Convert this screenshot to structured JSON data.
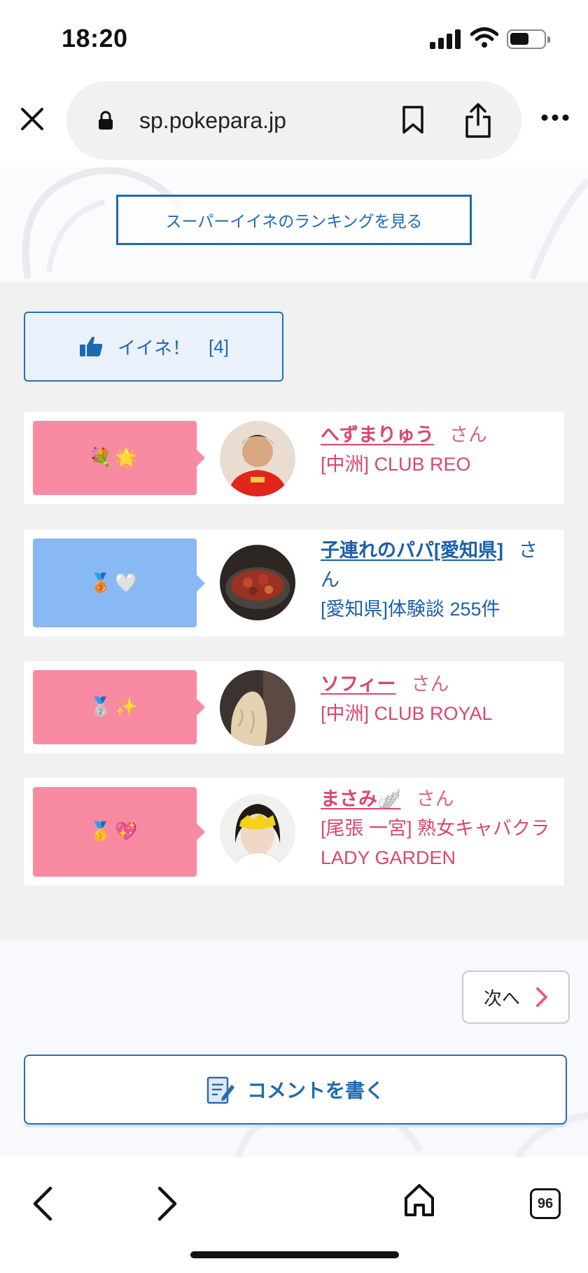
{
  "status_bar": {
    "time": "18:20"
  },
  "browser": {
    "url": "sp.pokepara.jp"
  },
  "ranking_link": {
    "label": "スーパーイイネのランキングを見る"
  },
  "like_button": {
    "label": "イイネ！",
    "count": "[4]"
  },
  "likes": [
    {
      "stamp": "💐🌟",
      "stamp_color": "#f88ba1",
      "name": "へずまりゅう",
      "suffix": "さん",
      "detail": "[中洲] CLUB REO",
      "text_color": "#d8476e",
      "avatar_icon": "person-red-shirt-avatar"
    },
    {
      "stamp": "🥉🤍",
      "stamp_color": "#89b9f5",
      "name": "子連れのパパ[愛知県]",
      "suffix": "さん",
      "detail": "[愛知県]体験談 255件",
      "text_color": "#1d5fa8",
      "avatar_icon": "food-dish-avatar"
    },
    {
      "stamp": "🥈✨",
      "stamp_color": "#f88ba1",
      "name": "ソフィー",
      "suffix": "さん",
      "detail": "[中洲] CLUB ROYAL",
      "text_color": "#d8476e",
      "avatar_icon": "woman-hair-avatar"
    },
    {
      "stamp": "🥇💖",
      "stamp_color": "#f88ba1",
      "name": "まさみ🪽",
      "suffix": "さん",
      "detail": "[尾張 一宮] 熟女キャバクラ LADY GARDEN",
      "text_color": "#d8476e",
      "avatar_icon": "woman-face-avatar"
    }
  ],
  "pagination": {
    "next_label": "次へ"
  },
  "comment_button": {
    "label": "コメントを書く"
  },
  "toolbar": {
    "tab_count": "96"
  }
}
